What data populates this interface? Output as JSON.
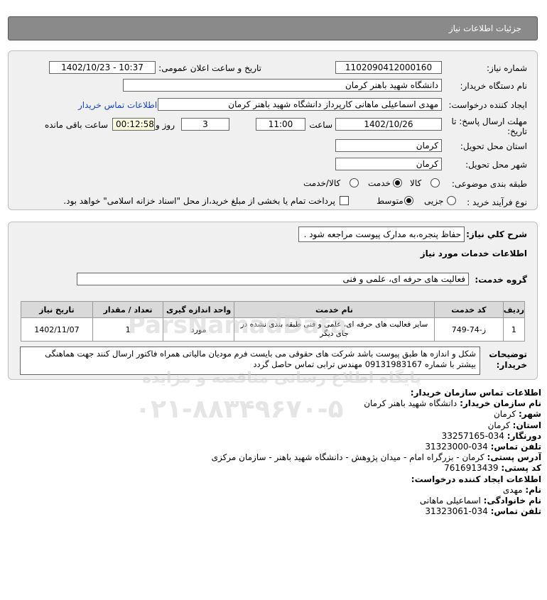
{
  "header": {
    "title": "جزئیات اطلاعات نیاز"
  },
  "form": {
    "need_number_label": "شماره نیاز:",
    "need_number": "1102090412000160",
    "announce_label": "تاریخ و ساعت اعلان عمومی:",
    "announce_value": "1402/10/23 - 10:37",
    "buyer_org_label": "نام دستگاه خریدار:",
    "buyer_org": "دانشگاه شهید باهنر کرمان",
    "creator_label": "ایجاد کننده درخواست:",
    "creator": "مهدی اسماعیلی ماهانی  کارپرداز دانشگاه شهید باهنر کرمان",
    "contact_link": "اطلاعات تماس خریدار",
    "deadline_label": "مهلت ارسال پاسخ: تا تاریخ:",
    "deadline_date": "1402/10/26",
    "time_label": "ساعت",
    "deadline_time": "11:00",
    "days_value": "3",
    "days_label": "روز و",
    "remaining_value": "00:12:58",
    "remaining_label": "ساعت باقی مانده",
    "province_label": "استان محل تحویل:",
    "province": "کرمان",
    "city_label": "شهر محل تحویل:",
    "city": "کرمان",
    "category_label": "طبقه بندی موضوعی:",
    "category_options": [
      "کالا",
      "خدمت",
      "کالا/خدمت"
    ],
    "category_selected": 1,
    "process_label": "نوع فرآیند خرید :",
    "process_options": [
      "جزیی",
      "متوسط"
    ],
    "process_selected": 1,
    "treasury_text": "پرداخت تمام یا بخشی از مبلغ خرید،از محل \"اسناد خزانه اسلامی\" خواهد بود."
  },
  "details": {
    "summary_label": "شرح کلي نياز:",
    "summary": "حفاظ پنجره،به مدارک پیوست مراجعه شود .",
    "services_heading": "اطلاعات خدمات مورد نیاز",
    "service_group_label": "گروه خدمت:",
    "service_group": "فعالیت های حرفه ای، علمی و فنی",
    "table": {
      "headers": [
        "ردیف",
        "کد خدمت",
        "نام خدمت",
        "واحد اندازه گیری",
        "تعداد / مقدار",
        "تاریخ نیاز"
      ],
      "rows": [
        [
          "1",
          "ز-74-749",
          "سایر فعالیت های حرفه ای، علمی و فنی طبقه بندی نشده در جای دیگر",
          "مورد",
          "1",
          "1402/11/07"
        ]
      ]
    },
    "notes_label": "توضیحات خریدار:",
    "notes": "شکل و اندازه ها طبق پیوست باشد شرکت های حقوقی می بایست فرم مودیان مالیاتی همراه فاکتور ارسال کنند جهت هماهنگی بیشتر با شماره 09131983167 مهندس ترابی تماس حاصل گردد"
  },
  "contact": {
    "org_heading": "اطلاعات تماس سازمان خریدار:",
    "org_name_label": "نام سازمان خریدار:",
    "org_name": "دانشگاه شهید باهنر کرمان",
    "city_label": "شهر:",
    "city": "کرمان",
    "province_label": "استان:",
    "province": "کرمان",
    "fax_label": "دورنگار:",
    "fax": "034-33257165",
    "phone_label": "تلفن تماس:",
    "phone": "034-31323000",
    "address_label": "آدرس پستی:",
    "address": "کرمان - بزرگراه امام - میدان پژوهش - دانشگاه شهید باهنر - سازمان مرکزی",
    "postal_label": "کد پستی:",
    "postal": "7616913439",
    "creator_heading": "اطلاعات ایجاد کننده درخواست:",
    "first_name_label": "نام:",
    "first_name": "مهدی",
    "last_name_label": "نام خانوادگی:",
    "last_name": "اسماعیلی ماهانی",
    "creator_phone_label": "تلفن تماس:",
    "creator_phone": "034-31323061"
  },
  "watermark": {
    "brand": "ParsNamadData",
    "tagline": "پایگاه اطلاع رسانی مناقصه و مزایده",
    "phone": "۰۲۱-۸۸۳۴۹۶۷۰-۵"
  }
}
